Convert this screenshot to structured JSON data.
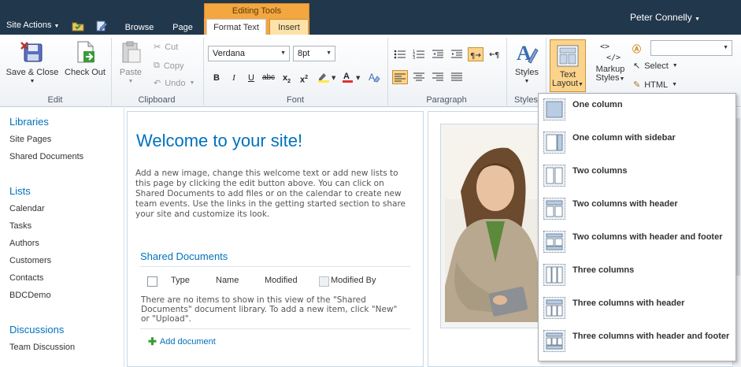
{
  "topbar": {
    "site_actions": "Site Actions",
    "tabs": [
      {
        "label": "Browse"
      },
      {
        "label": "Page"
      }
    ],
    "contextual_group": "Editing Tools",
    "format_text_tab": "Format Text",
    "insert_tab": "Insert",
    "user": "Peter Connelly"
  },
  "ribbon": {
    "edit": {
      "label": "Edit",
      "save_close": [
        "Save &",
        "Close"
      ],
      "check_out": "Check Out"
    },
    "clipboard": {
      "label": "Clipboard",
      "paste": "Paste",
      "cut": "Cut",
      "copy": "Copy",
      "undo": "Undo"
    },
    "font": {
      "label": "Font",
      "family": "Verdana",
      "size": "8pt",
      "bold": "B",
      "italic": "I",
      "underline": "U",
      "strike": "abc",
      "subscript": "x",
      "superscript": "x"
    },
    "paragraph": {
      "label": "Paragraph"
    },
    "styles": {
      "label": "Styles",
      "styles_button": "Styles"
    },
    "layout": {
      "text_layout": [
        "Text",
        "Layout"
      ],
      "markup_styles": [
        "Markup",
        "Styles"
      ],
      "select": "Select",
      "html": "HTML"
    }
  },
  "leftnav": {
    "libraries_heading": "Libraries",
    "libraries": [
      "Site Pages",
      "Shared Documents"
    ],
    "lists_heading": "Lists",
    "lists": [
      "Calendar",
      "Tasks",
      "Authors",
      "Customers",
      "Contacts",
      "BDCDemo"
    ],
    "discussions_heading": "Discussions",
    "discussions": [
      "Team Discussion"
    ]
  },
  "content": {
    "welcome_title": "Welcome to your site!",
    "intro": "Add a new image, change this welcome text or add new lists to this page by clicking the edit button above. You can click on Shared Documents to add files or on the calendar to create new team events. Use the links in the getting started section to share your site and customize its look.",
    "webpart_title": "Shared Documents",
    "columns": [
      "Type",
      "Name",
      "Modified",
      "Modified By"
    ],
    "empty_message": "There are no items to show in this view of the \"Shared Documents\" document library. To add a new item, click \"New\" or \"Upload\".",
    "add_document": "Add document"
  },
  "text_layout_menu": [
    {
      "label": "One column",
      "icon": "layout-one-column-icon"
    },
    {
      "label": "One column with sidebar",
      "icon": "layout-one-column-sidebar-icon"
    },
    {
      "label": "Two columns",
      "icon": "layout-two-columns-icon"
    },
    {
      "label": "Two columns with header",
      "icon": "layout-two-columns-header-icon"
    },
    {
      "label": "Two columns with header and footer",
      "icon": "layout-two-columns-header-footer-icon"
    },
    {
      "label": "Three columns",
      "icon": "layout-three-columns-icon"
    },
    {
      "label": "Three columns with header",
      "icon": "layout-three-columns-header-icon"
    },
    {
      "label": "Three columns with header and footer",
      "icon": "layout-three-columns-header-footer-icon"
    }
  ],
  "colors": {
    "topbar": "#21374c",
    "accent_blue": "#0072bc",
    "context_orange": "#f4a640",
    "active_highlight": "#fcd38a"
  }
}
